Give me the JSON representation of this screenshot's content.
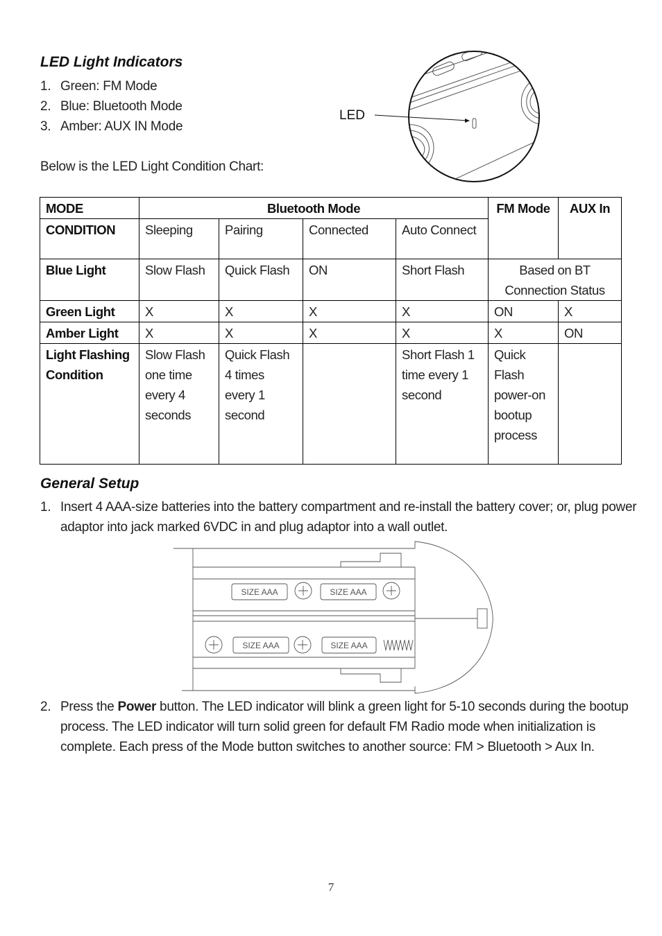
{
  "led_section": {
    "title": "LED Light Indicators",
    "items": [
      {
        "num": "1.",
        "text": "Green: FM Mode"
      },
      {
        "num": "2.",
        "text": "Blue: Bluetooth Mode"
      },
      {
        "num": "3.",
        "text": "Amber: AUX IN Mode"
      }
    ],
    "chart_intro": "Below is the LED Light Condition Chart:",
    "figure_label": "LED"
  },
  "led_table": {
    "mode_header": "MODE",
    "bluetooth_header": "Bluetooth Mode",
    "fm_header": "FM Mode",
    "aux_header": "AUX In",
    "condition_header": "CONDITION",
    "conditions": [
      "Sleeping",
      "Pairing",
      "Connected",
      "Auto Connect"
    ],
    "rows": [
      {
        "label": "Blue Light",
        "cells": [
          "Slow Flash",
          "Quick Flash",
          "ON",
          "Short Flash"
        ],
        "fm_aux_merged": "Based on BT Connection Status"
      },
      {
        "label": "Green Light",
        "cells": [
          "X",
          "X",
          "X",
          "X"
        ],
        "fm": "ON",
        "aux": "X"
      },
      {
        "label": "Amber Light",
        "cells": [
          "X",
          "X",
          "X",
          "X"
        ],
        "fm": "X",
        "aux": "ON"
      },
      {
        "label": "Light Flashing Condition",
        "cells": [
          "Slow Flash one time every 4 seconds",
          "Quick Flash 4 times every 1 second",
          "",
          "Short Flash 1 time every 1 second"
        ],
        "fm": "Quick Flash power-on bootup process",
        "aux": ""
      }
    ]
  },
  "setup_section": {
    "title": "General Setup",
    "steps": [
      {
        "num": "1.",
        "text": "Insert 4 AAA-size batteries into the battery compartment and re-install the battery cover; or, plug power adaptor into jack marked 6VDC in and plug adaptor into a wall outlet."
      },
      {
        "num": "2.",
        "pre": "Press the ",
        "bold": "Power",
        "post": " button. The LED indicator will blink a green light for 5-10 seconds during the bootup process. The LED indicator will turn solid green for default FM Radio mode when initialization is complete. Each press of the Mode button switches to another source: FM > Bluetooth > Aux In."
      }
    ],
    "battery_label": "SIZE AAA"
  },
  "page_number": "7"
}
